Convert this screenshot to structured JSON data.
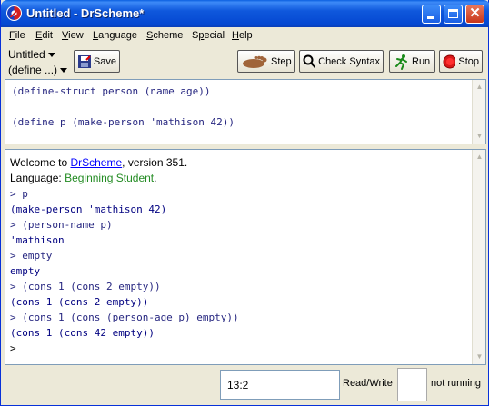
{
  "window": {
    "title": "Untitled - DrScheme*",
    "close_glyph": "✕"
  },
  "menu": {
    "items": [
      "File",
      "Edit",
      "View",
      "Language",
      "Scheme",
      "Special",
      "Help"
    ],
    "mnemonics": [
      "F",
      "E",
      "V",
      "L",
      "S",
      "p",
      "H"
    ]
  },
  "toolbar": {
    "file_name": "Untitled",
    "define_menu": "(define ...)",
    "save_label": "Save",
    "step_label": "Step",
    "check_syntax_label": "Check Syntax",
    "run_label": "Run",
    "stop_label": "Stop"
  },
  "definitions": {
    "lines": [
      "(define-struct person (name age))",
      "",
      "(define p (make-person 'mathison 42))"
    ]
  },
  "interactions": {
    "welcome_prefix": "Welcome to ",
    "welcome_link": "DrScheme",
    "welcome_suffix": ", version 351.",
    "language_prefix": "Language: ",
    "language_name": "Beginning Student",
    "language_suffix": ".",
    "lines": [
      "> p",
      "(make-person 'mathison 42)",
      "> (person-name p)",
      "'mathison",
      "> empty",
      "empty",
      "> (cons 1 (cons 2 empty))",
      "(cons 1 (cons 2 empty))",
      "> (cons 1 (cons (person-age p) empty))",
      "(cons 1 (cons 42 empty))",
      ">"
    ]
  },
  "status": {
    "position": "13:2",
    "mode": "Read/Write",
    "running": "not running"
  },
  "colors": {
    "titlebar": "#0548d2",
    "code_keyword": "#262680",
    "code_number": "#228b22",
    "link": "#0000ff"
  }
}
